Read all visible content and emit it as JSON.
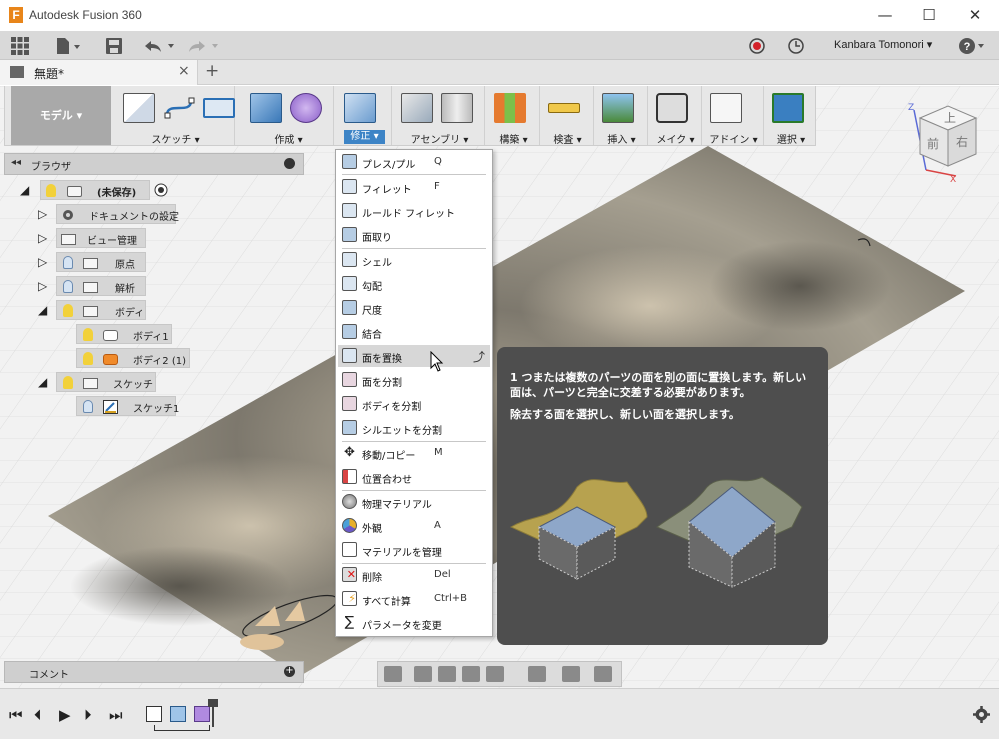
{
  "window": {
    "app_icon_letter": "F",
    "title": "Autodesk Fusion 360",
    "controls": {
      "minimize": "—",
      "maximize": "☐",
      "close": "✕"
    }
  },
  "quick_access": {
    "user_name": "Kanbara Tomonori",
    "help_label": "?"
  },
  "document_tab": {
    "name": "無題*",
    "close": "×",
    "new_tab": "+"
  },
  "ribbon": {
    "mode": "モデル",
    "groups": [
      {
        "label": "スケッチ ▾"
      },
      {
        "label": "作成 ▾"
      },
      {
        "label": "修正 ▾"
      },
      {
        "label": "アセンブリ ▾"
      },
      {
        "label": "構築 ▾"
      },
      {
        "label": "検査 ▾"
      },
      {
        "label": "挿入 ▾"
      },
      {
        "label": "メイク ▾"
      },
      {
        "label": "アドイン ▾"
      },
      {
        "label": "選択 ▾"
      }
    ]
  },
  "browser": {
    "collapse_arrows": "◂◂",
    "title": "ブラウザ",
    "items": [
      {
        "label": "(未保存)"
      },
      {
        "label": "ドキュメントの設定"
      },
      {
        "label": "ビュー管理"
      },
      {
        "label": "原点"
      },
      {
        "label": "解析"
      },
      {
        "label": "ボディ"
      },
      {
        "label": "ボディ1"
      },
      {
        "label": "ボディ2 (1)"
      },
      {
        "label": "スケッチ"
      },
      {
        "label": "スケッチ1"
      }
    ]
  },
  "comment_bar": {
    "title": "コメント",
    "plus": "+"
  },
  "modify_menu": {
    "items": [
      {
        "label": "プレス/プル",
        "shortcut": "Q",
        "icon": "press-pull-icon"
      },
      {
        "label": "フィレット",
        "shortcut": "F",
        "icon": "fillet-icon"
      },
      {
        "label": "ルールド フィレット",
        "shortcut": "",
        "icon": "rule-fillet-icon"
      },
      {
        "label": "面取り",
        "shortcut": "",
        "icon": "chamfer-icon"
      },
      {
        "label": "シェル",
        "shortcut": "",
        "icon": "shell-icon"
      },
      {
        "label": "勾配",
        "shortcut": "",
        "icon": "draft-icon"
      },
      {
        "label": "尺度",
        "shortcut": "",
        "icon": "scale-icon"
      },
      {
        "label": "結合",
        "shortcut": "",
        "icon": "combine-icon"
      },
      {
        "label": "面を置換",
        "shortcut": "",
        "icon": "replace-face-icon"
      },
      {
        "label": "面を分割",
        "shortcut": "",
        "icon": "split-face-icon"
      },
      {
        "label": "ボディを分割",
        "shortcut": "",
        "icon": "split-body-icon"
      },
      {
        "label": "シルエットを分割",
        "shortcut": "",
        "icon": "silhouette-split-icon"
      },
      {
        "label": "移動/コピー",
        "shortcut": "M",
        "icon": "move-icon"
      },
      {
        "label": "位置合わせ",
        "shortcut": "",
        "icon": "align-icon"
      },
      {
        "label": "物理マテリアル",
        "shortcut": "",
        "icon": "physical-material-icon"
      },
      {
        "label": "外観",
        "shortcut": "A",
        "icon": "appearance-icon"
      },
      {
        "label": "マテリアルを管理",
        "shortcut": "",
        "icon": "manage-materials-icon"
      },
      {
        "label": "削除",
        "shortcut": "Del",
        "icon": "delete-icon"
      },
      {
        "label": "すべて計算",
        "shortcut": "Ctrl+B",
        "icon": "compute-all-icon"
      },
      {
        "label": "パラメータを変更",
        "shortcut": "",
        "icon": "parameters-icon"
      }
    ]
  },
  "tooltip": {
    "line1": "1 つまたは複数のパーツの面を別の面に置換します。新しい面は、パーツと完全に交差する必要があります。",
    "line2": "除去する面を選択し、新しい面を選択します。"
  },
  "viewcube": {
    "top": "上",
    "front": "前",
    "right": "右",
    "axis_x": "X",
    "axis_z": "Z"
  },
  "timeline": {
    "first": "⏮",
    "prev": "⏴",
    "play": "▶",
    "next": "⏵",
    "last": "⏭"
  },
  "colors": {
    "accent_blue": "#3d84c6",
    "tooltip_bg": "#4e4e4e",
    "surface": "#8f8a7c",
    "bulb_yellow": "#f2d13a"
  }
}
